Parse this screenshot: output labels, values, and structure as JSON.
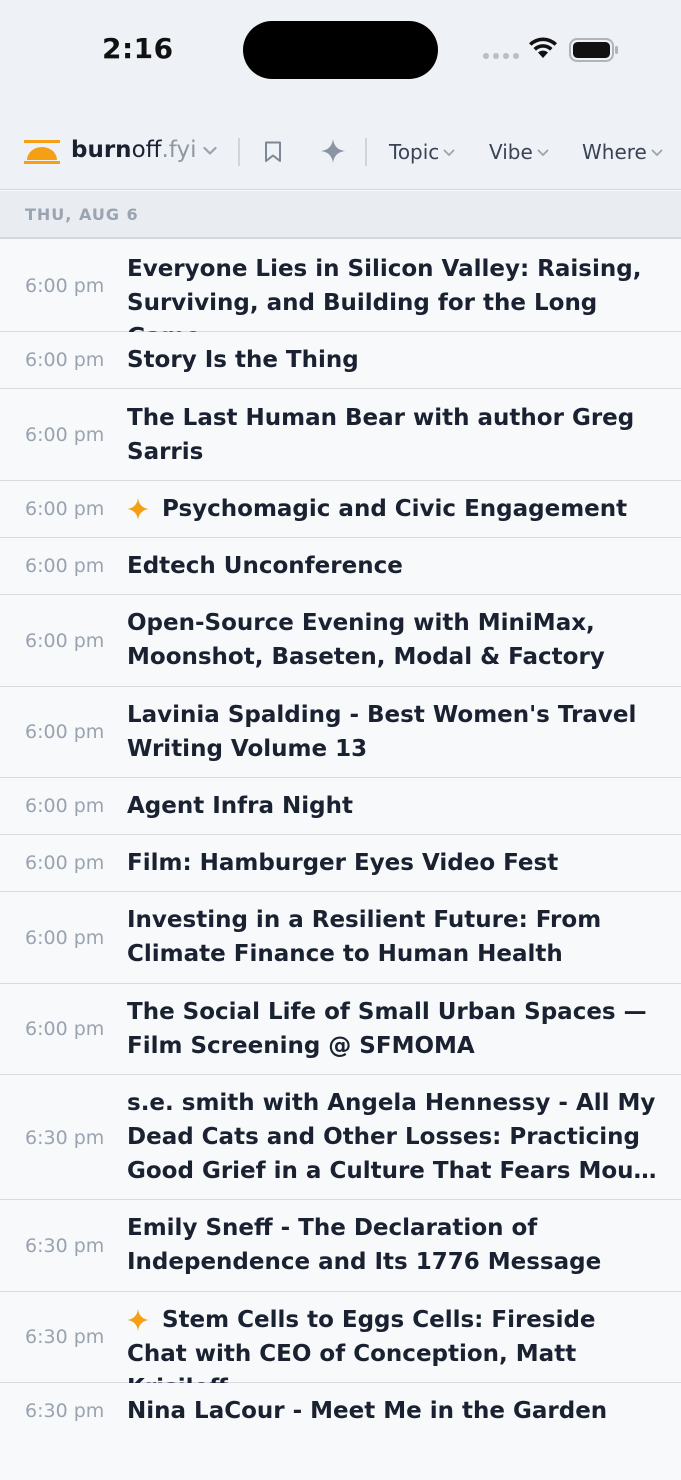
{
  "status_bar": {
    "time": "2:16"
  },
  "header": {
    "brand": {
      "part1": "burn",
      "part2": "off",
      "part3": ".fyi"
    },
    "filters": [
      {
        "label": "Topic"
      },
      {
        "label": "Vibe"
      },
      {
        "label": "Where"
      }
    ]
  },
  "date_header": "THU, AUG 6",
  "events": [
    {
      "time": "6:00 pm",
      "title": "Everyone Lies in Silicon Valley: Raising, Surviving, and Building for the Long Game",
      "featured": false
    },
    {
      "time": "6:00 pm",
      "title": "Story Is the Thing",
      "featured": false
    },
    {
      "time": "6:00 pm",
      "title": "The Last Human Bear with author Greg Sarris",
      "featured": false
    },
    {
      "time": "6:00 pm",
      "title": "Psychomagic and Civic Engagement",
      "featured": true
    },
    {
      "time": "6:00 pm",
      "title": "Edtech Unconference",
      "featured": false
    },
    {
      "time": "6:00 pm",
      "title": "Open-Source Evening with MiniMax, Moonshot, Baseten, Modal & Factory",
      "featured": false
    },
    {
      "time": "6:00 pm",
      "title": "Lavinia Spalding - Best Women's Travel Writing Volume 13",
      "featured": false
    },
    {
      "time": "6:00 pm",
      "title": "Agent Infra Night",
      "featured": false
    },
    {
      "time": "6:00 pm",
      "title": "Film: Hamburger Eyes Video Fest",
      "featured": false
    },
    {
      "time": "6:00 pm",
      "title": "Investing in a Resilient Future: From Climate Finance to Human Health",
      "featured": false
    },
    {
      "time": "6:00 pm",
      "title": "The Social Life of Small Urban Spaces — Film Screening @ SFMOMA",
      "featured": false
    },
    {
      "time": "6:30 pm",
      "title_lines": [
        "s.e. smith with Angela Hennessy - All My",
        "Dead Cats and Other Losses: Practicing",
        "Good Grief in a Culture That Fears Mourni…"
      ],
      "featured": false
    },
    {
      "time": "6:30 pm",
      "title": "Emily Sneff - The Declaration of Independence and Its 1776 Message",
      "featured": false
    },
    {
      "time": "6:30 pm",
      "title": "Stem Cells to Eggs Cells: Fireside Chat with CEO of Conception, Matt Krisiloff",
      "featured": true
    },
    {
      "time": "6:30 pm",
      "title": "Nina LaCour - Meet Me in the Garden",
      "featured": false
    }
  ],
  "colors": {
    "accent": "#f5a014",
    "text": "#1a2130",
    "muted": "#9aa3b0"
  }
}
